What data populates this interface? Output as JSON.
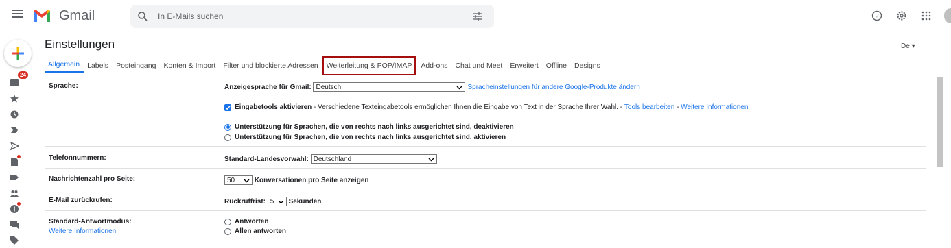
{
  "app": {
    "name": "Gmail"
  },
  "search": {
    "placeholder": "In E-Mails suchen"
  },
  "rail": {
    "inbox_badge": "24"
  },
  "page": {
    "title": "Einstellungen",
    "language_toggle": "De"
  },
  "tabs": [
    {
      "label": "Allgemein",
      "active": true
    },
    {
      "label": "Labels"
    },
    {
      "label": "Posteingang"
    },
    {
      "label": "Konten & Import"
    },
    {
      "label": "Filter und blockierte Adressen"
    },
    {
      "label": "Weiterleitung & POP/IMAP",
      "highlighted": true
    },
    {
      "label": "Add-ons"
    },
    {
      "label": "Chat und Meet"
    },
    {
      "label": "Erweitert"
    },
    {
      "label": "Offline"
    },
    {
      "label": "Designs"
    }
  ],
  "settings": {
    "language": {
      "label": "Sprache:",
      "display_label": "Anzeigesprache für Gmail:",
      "display_value": "Deutsch",
      "other_products_link": "Spracheinstellungen für andere Google-Produkte ändern",
      "input_tools_label": "Eingabetools aktivieren",
      "input_tools_desc": " - Verschiedene Texteingabetools ermöglichen Ihnen die Eingabe von Text in der Sprache Ihrer Wahl. - ",
      "edit_tools_link": "Tools bearbeiten",
      "sep": " - ",
      "more_info_link": "Weitere Informationen",
      "rtl_off": "Unterstützung für Sprachen, die von rechts nach links ausgerichtet sind, deaktivieren",
      "rtl_on": "Unterstützung für Sprachen, die von rechts nach links ausgerichtet sind, aktivieren"
    },
    "phone": {
      "label": "Telefonnummern:",
      "country_label": "Standard-Landesvorwahl:",
      "country_value": "Deutschland"
    },
    "page_size": {
      "label": "Nachrichtenzahl pro Seite:",
      "value": "50",
      "suffix": "Konversationen pro Seite anzeigen"
    },
    "undo_send": {
      "label": "E-Mail zurückrufen:",
      "prefix": "Rückruffrist:",
      "value": "5",
      "suffix": "Sekunden"
    },
    "reply_mode": {
      "label": "Standard-Antwortmodus:",
      "more_info_link": "Weitere Informationen",
      "option_reply": "Antworten",
      "option_reply_all": "Allen antworten"
    }
  },
  "colors": {
    "accent": "#1a73e8",
    "badge": "#d93025",
    "highlight_outline": "#a50e0e"
  }
}
